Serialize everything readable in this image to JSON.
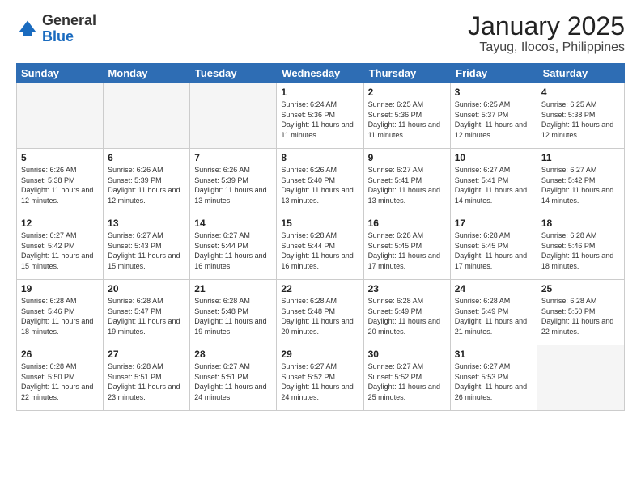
{
  "header": {
    "logo_general": "General",
    "logo_blue": "Blue",
    "month": "January 2025",
    "location": "Tayug, Ilocos, Philippines"
  },
  "days_of_week": [
    "Sunday",
    "Monday",
    "Tuesday",
    "Wednesday",
    "Thursday",
    "Friday",
    "Saturday"
  ],
  "weeks": [
    [
      {
        "day": "",
        "sunrise": "",
        "sunset": "",
        "daylight": "",
        "empty": true
      },
      {
        "day": "",
        "sunrise": "",
        "sunset": "",
        "daylight": "",
        "empty": true
      },
      {
        "day": "",
        "sunrise": "",
        "sunset": "",
        "daylight": "",
        "empty": true
      },
      {
        "day": "1",
        "sunrise": "Sunrise: 6:24 AM",
        "sunset": "Sunset: 5:36 PM",
        "daylight": "Daylight: 11 hours and 11 minutes.",
        "empty": false
      },
      {
        "day": "2",
        "sunrise": "Sunrise: 6:25 AM",
        "sunset": "Sunset: 5:36 PM",
        "daylight": "Daylight: 11 hours and 11 minutes.",
        "empty": false
      },
      {
        "day": "3",
        "sunrise": "Sunrise: 6:25 AM",
        "sunset": "Sunset: 5:37 PM",
        "daylight": "Daylight: 11 hours and 12 minutes.",
        "empty": false
      },
      {
        "day": "4",
        "sunrise": "Sunrise: 6:25 AM",
        "sunset": "Sunset: 5:38 PM",
        "daylight": "Daylight: 11 hours and 12 minutes.",
        "empty": false
      }
    ],
    [
      {
        "day": "5",
        "sunrise": "Sunrise: 6:26 AM",
        "sunset": "Sunset: 5:38 PM",
        "daylight": "Daylight: 11 hours and 12 minutes.",
        "empty": false
      },
      {
        "day": "6",
        "sunrise": "Sunrise: 6:26 AM",
        "sunset": "Sunset: 5:39 PM",
        "daylight": "Daylight: 11 hours and 12 minutes.",
        "empty": false
      },
      {
        "day": "7",
        "sunrise": "Sunrise: 6:26 AM",
        "sunset": "Sunset: 5:39 PM",
        "daylight": "Daylight: 11 hours and 13 minutes.",
        "empty": false
      },
      {
        "day": "8",
        "sunrise": "Sunrise: 6:26 AM",
        "sunset": "Sunset: 5:40 PM",
        "daylight": "Daylight: 11 hours and 13 minutes.",
        "empty": false
      },
      {
        "day": "9",
        "sunrise": "Sunrise: 6:27 AM",
        "sunset": "Sunset: 5:41 PM",
        "daylight": "Daylight: 11 hours and 13 minutes.",
        "empty": false
      },
      {
        "day": "10",
        "sunrise": "Sunrise: 6:27 AM",
        "sunset": "Sunset: 5:41 PM",
        "daylight": "Daylight: 11 hours and 14 minutes.",
        "empty": false
      },
      {
        "day": "11",
        "sunrise": "Sunrise: 6:27 AM",
        "sunset": "Sunset: 5:42 PM",
        "daylight": "Daylight: 11 hours and 14 minutes.",
        "empty": false
      }
    ],
    [
      {
        "day": "12",
        "sunrise": "Sunrise: 6:27 AM",
        "sunset": "Sunset: 5:42 PM",
        "daylight": "Daylight: 11 hours and 15 minutes.",
        "empty": false
      },
      {
        "day": "13",
        "sunrise": "Sunrise: 6:27 AM",
        "sunset": "Sunset: 5:43 PM",
        "daylight": "Daylight: 11 hours and 15 minutes.",
        "empty": false
      },
      {
        "day": "14",
        "sunrise": "Sunrise: 6:27 AM",
        "sunset": "Sunset: 5:44 PM",
        "daylight": "Daylight: 11 hours and 16 minutes.",
        "empty": false
      },
      {
        "day": "15",
        "sunrise": "Sunrise: 6:28 AM",
        "sunset": "Sunset: 5:44 PM",
        "daylight": "Daylight: 11 hours and 16 minutes.",
        "empty": false
      },
      {
        "day": "16",
        "sunrise": "Sunrise: 6:28 AM",
        "sunset": "Sunset: 5:45 PM",
        "daylight": "Daylight: 11 hours and 17 minutes.",
        "empty": false
      },
      {
        "day": "17",
        "sunrise": "Sunrise: 6:28 AM",
        "sunset": "Sunset: 5:45 PM",
        "daylight": "Daylight: 11 hours and 17 minutes.",
        "empty": false
      },
      {
        "day": "18",
        "sunrise": "Sunrise: 6:28 AM",
        "sunset": "Sunset: 5:46 PM",
        "daylight": "Daylight: 11 hours and 18 minutes.",
        "empty": false
      }
    ],
    [
      {
        "day": "19",
        "sunrise": "Sunrise: 6:28 AM",
        "sunset": "Sunset: 5:46 PM",
        "daylight": "Daylight: 11 hours and 18 minutes.",
        "empty": false
      },
      {
        "day": "20",
        "sunrise": "Sunrise: 6:28 AM",
        "sunset": "Sunset: 5:47 PM",
        "daylight": "Daylight: 11 hours and 19 minutes.",
        "empty": false
      },
      {
        "day": "21",
        "sunrise": "Sunrise: 6:28 AM",
        "sunset": "Sunset: 5:48 PM",
        "daylight": "Daylight: 11 hours and 19 minutes.",
        "empty": false
      },
      {
        "day": "22",
        "sunrise": "Sunrise: 6:28 AM",
        "sunset": "Sunset: 5:48 PM",
        "daylight": "Daylight: 11 hours and 20 minutes.",
        "empty": false
      },
      {
        "day": "23",
        "sunrise": "Sunrise: 6:28 AM",
        "sunset": "Sunset: 5:49 PM",
        "daylight": "Daylight: 11 hours and 20 minutes.",
        "empty": false
      },
      {
        "day": "24",
        "sunrise": "Sunrise: 6:28 AM",
        "sunset": "Sunset: 5:49 PM",
        "daylight": "Daylight: 11 hours and 21 minutes.",
        "empty": false
      },
      {
        "day": "25",
        "sunrise": "Sunrise: 6:28 AM",
        "sunset": "Sunset: 5:50 PM",
        "daylight": "Daylight: 11 hours and 22 minutes.",
        "empty": false
      }
    ],
    [
      {
        "day": "26",
        "sunrise": "Sunrise: 6:28 AM",
        "sunset": "Sunset: 5:50 PM",
        "daylight": "Daylight: 11 hours and 22 minutes.",
        "empty": false
      },
      {
        "day": "27",
        "sunrise": "Sunrise: 6:28 AM",
        "sunset": "Sunset: 5:51 PM",
        "daylight": "Daylight: 11 hours and 23 minutes.",
        "empty": false
      },
      {
        "day": "28",
        "sunrise": "Sunrise: 6:27 AM",
        "sunset": "Sunset: 5:51 PM",
        "daylight": "Daylight: 11 hours and 24 minutes.",
        "empty": false
      },
      {
        "day": "29",
        "sunrise": "Sunrise: 6:27 AM",
        "sunset": "Sunset: 5:52 PM",
        "daylight": "Daylight: 11 hours and 24 minutes.",
        "empty": false
      },
      {
        "day": "30",
        "sunrise": "Sunrise: 6:27 AM",
        "sunset": "Sunset: 5:52 PM",
        "daylight": "Daylight: 11 hours and 25 minutes.",
        "empty": false
      },
      {
        "day": "31",
        "sunrise": "Sunrise: 6:27 AM",
        "sunset": "Sunset: 5:53 PM",
        "daylight": "Daylight: 11 hours and 26 minutes.",
        "empty": false
      },
      {
        "day": "",
        "sunrise": "",
        "sunset": "",
        "daylight": "",
        "empty": true
      }
    ]
  ]
}
